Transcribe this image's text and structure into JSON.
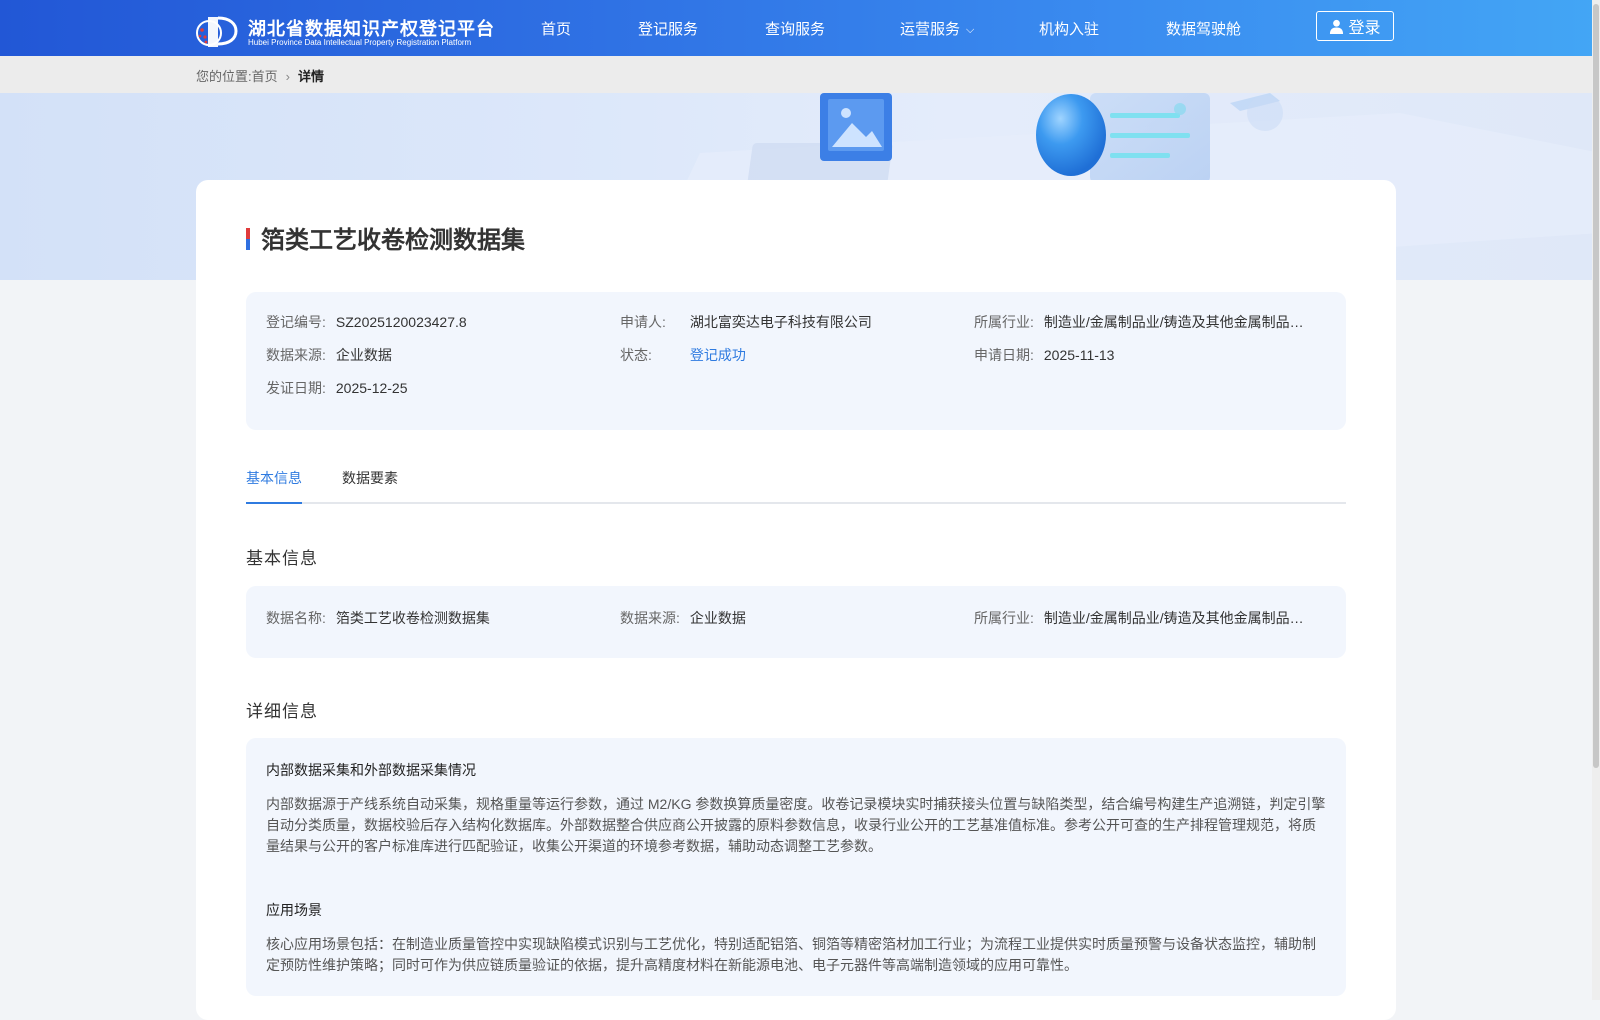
{
  "header": {
    "logo_cn": "湖北省数据知识产权登记平台",
    "logo_en": "Hubei Province Data Intellectual Property Registration Platform",
    "nav": [
      "首页",
      "登记服务",
      "查询服务",
      "运营服务",
      "机构入驻",
      "数据驾驶舱"
    ],
    "login": "登录"
  },
  "breadcrumb": {
    "prefix": "您的位置:",
    "home": "首页",
    "current": "详情"
  },
  "detail": {
    "title": "箔类工艺收卷检测数据集",
    "summary": {
      "reg_no_label": "登记编号:",
      "reg_no": "SZ2025120023427.8",
      "applicant_label": "申请人:",
      "applicant": "湖北富奕达电子科技有限公司",
      "industry_label": "所属行业:",
      "industry": "制造业/金属制品业/铸造及其他金属制品制造",
      "source_label": "数据来源:",
      "source": "企业数据",
      "status_label": "状态:",
      "status": "登记成功",
      "apply_date_label": "申请日期:",
      "apply_date": "2025-11-13",
      "cert_date_label": "发证日期:",
      "cert_date": "2025-12-25"
    },
    "tabs": [
      "基本信息",
      "数据要素"
    ],
    "basic": {
      "heading": "基本信息",
      "name_label": "数据名称:",
      "name": "箔类工艺收卷检测数据集",
      "source_label": "数据来源:",
      "source": "企业数据",
      "industry_label": "所属行业:",
      "industry": "制造业/金属制品业/铸造及其他金属制品制造"
    },
    "more": {
      "heading": "详细信息",
      "s1_title": "内部数据采集和外部数据采集情况",
      "s1_text": "内部数据源于产线系统自动采集，规格重量等运行参数，通过 M2/KG 参数换算质量密度。收卷记录模块实时捕获接头位置与缺陷类型，结合编号构建生产追溯链，判定引擎自动分类质量，数据校验后存入结构化数据库。外部数据整合供应商公开披露的原料参数信息，收录行业公开的工艺基准值标准。参考公开可查的生产排程管理规范，将质量结果与公开的客户标准库进行匹配验证，收集公开渠道的环境参考数据，辅助动态调整工艺参数。",
      "s2_title": "应用场景",
      "s2_text": "核心应用场景包括：在制造业质量管控中实现缺陷模式识别与工艺优化，特别适配铝箔、铜箔等精密箔材加工行业；为流程工业提供实时质量预警与设备状态监控，辅助制定预防性维护策略；同时可作为供应链质量验证的依据，提升高精度材料在新能源电池、电子元器件等高端制造领域的应用可靠性。"
    }
  },
  "colors": {
    "accent": "#2f7be0",
    "nav_start": "#2257d6",
    "nav_end": "#43a6f5"
  }
}
